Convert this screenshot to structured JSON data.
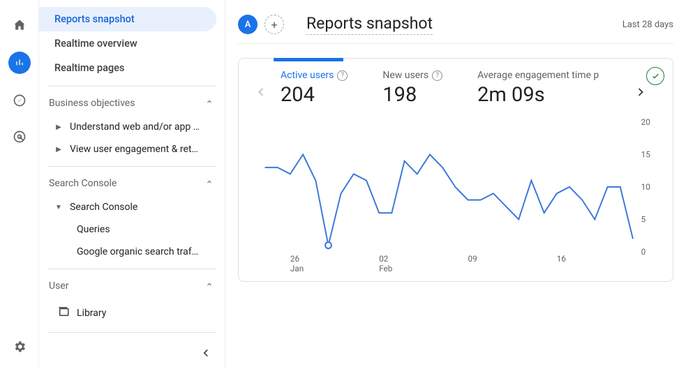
{
  "rail": {
    "letter": "A"
  },
  "sidebar": {
    "top": [
      "Reports snapshot",
      "Realtime overview",
      "Realtime pages"
    ],
    "sections": [
      {
        "title": "Business objectives",
        "items": [
          "Understand web and/or app t…",
          "View user engagement & rete…"
        ]
      },
      {
        "title": "Search Console",
        "parent": "Search Console",
        "children": [
          "Queries",
          "Google organic search traf…"
        ]
      },
      {
        "title": "User"
      }
    ],
    "library": "Library"
  },
  "header": {
    "title": "Reports snapshot",
    "range": "Last 28 days"
  },
  "metrics": [
    {
      "label": "Active users",
      "value": "204",
      "help": true,
      "active": true
    },
    {
      "label": "New users",
      "value": "198",
      "help": true
    },
    {
      "label": "Average engagement time per session",
      "short": "Average engagement time p",
      "value": "2m 09s"
    }
  ],
  "chart_data": {
    "type": "line",
    "ylabel": "",
    "xlabel": "",
    "ylim": [
      0,
      20
    ],
    "yticks": [
      0,
      5,
      10,
      15,
      20
    ],
    "x_major": [
      {
        "pos": 2,
        "top": "26",
        "bot": "Jan"
      },
      {
        "pos": 9,
        "top": "02",
        "bot": "Feb"
      },
      {
        "pos": 16,
        "top": "09",
        "bot": ""
      },
      {
        "pos": 23,
        "top": "16",
        "bot": ""
      }
    ],
    "series": [
      {
        "name": "Active users",
        "values": [
          13,
          13,
          12,
          15,
          11,
          1,
          9,
          12,
          11,
          6,
          6,
          14,
          12,
          15,
          13,
          10,
          8,
          8,
          9,
          7,
          5,
          11,
          6,
          9,
          10,
          8,
          5,
          10,
          10,
          2
        ],
        "highlight_index": 5
      }
    ]
  }
}
